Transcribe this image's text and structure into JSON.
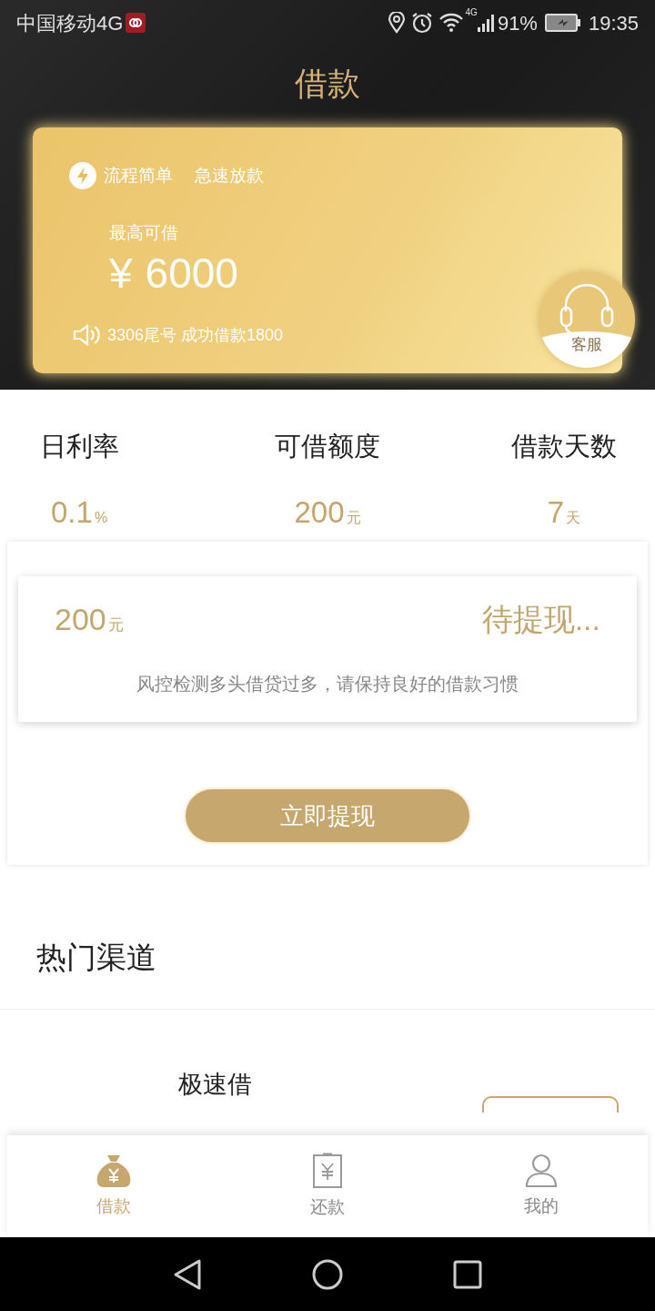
{
  "status_bar": {
    "carrier": "中国移动4G",
    "network": "4G",
    "battery": "91%",
    "time": "19:35"
  },
  "header": {
    "title": "借款"
  },
  "hero_card": {
    "features": [
      "流程简单",
      "急速放款"
    ],
    "label": "最高可借",
    "currency": "¥",
    "amount": "6000",
    "notice": "3306尾号 成功借款1800",
    "service": "客服"
  },
  "stats": [
    {
      "label": "日利率",
      "value": "0.1",
      "unit": "%"
    },
    {
      "label": "可借额度",
      "value": "200",
      "unit": "元"
    },
    {
      "label": "借款天数",
      "value": "7",
      "unit": "天"
    }
  ],
  "withdraw": {
    "amount": "200",
    "unit": "元",
    "status": "待提现...",
    "message": "风控检测多头借贷过多，请保持良好的借款习惯",
    "button": "立即提现"
  },
  "channels": {
    "title": "热门渠道",
    "items": [
      {
        "name": "极速借"
      }
    ]
  },
  "tab_bar": [
    {
      "label": "借款",
      "kind": "money-bag",
      "selected": true
    },
    {
      "label": "还款",
      "kind": "bill",
      "selected": false
    },
    {
      "label": "我的",
      "kind": "user",
      "selected": false
    }
  ]
}
